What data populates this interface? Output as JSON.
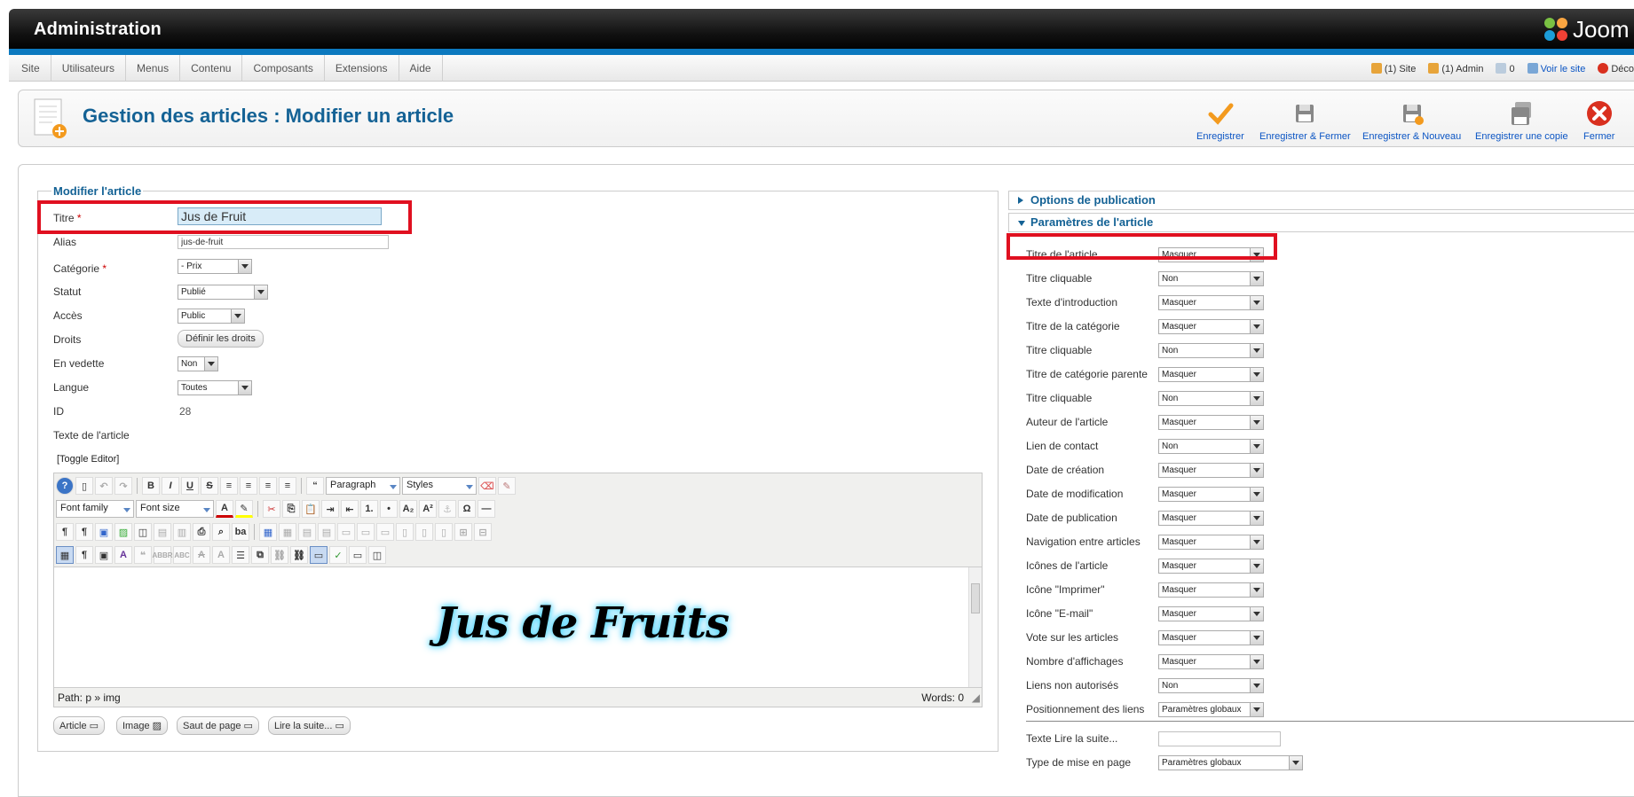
{
  "header": {
    "app_title": "Administration",
    "logo_text": "Joom"
  },
  "menu": {
    "items": [
      "Site",
      "Utilisateurs",
      "Menus",
      "Contenu",
      "Composants",
      "Extensions",
      "Aide"
    ]
  },
  "status": {
    "site": "(1) Site",
    "admin": "(1) Admin",
    "messages": "0",
    "view_site": "Voir le site",
    "logout": "Déco"
  },
  "toolbar": {
    "page_title": "Gestion des articles : Modifier un article",
    "buttons": [
      {
        "label": "Enregistrer",
        "icon": "checkmark-icon"
      },
      {
        "label": "Enregistrer & Fermer",
        "icon": "save-icon"
      },
      {
        "label": "Enregistrer & Nouveau",
        "icon": "save-new-icon"
      },
      {
        "label": "Enregistrer une copie",
        "icon": "save-copy-icon"
      },
      {
        "label": "Fermer",
        "icon": "close-icon"
      }
    ]
  },
  "form": {
    "legend": "Modifier l'article",
    "fields": {
      "title_label": "Titre",
      "title_value": "Jus de Fruit",
      "alias_label": "Alias",
      "alias_value": "jus-de-fruit",
      "category_label": "Catégorie",
      "category_value": "- Prix",
      "status_label": "Statut",
      "status_value": "Publié",
      "access_label": "Accès",
      "access_value": "Public",
      "rights_label": "Droits",
      "rights_button": "Définir les droits",
      "featured_label": "En vedette",
      "featured_value": "Non",
      "language_label": "Langue",
      "language_value": "Toutes",
      "id_label": "ID",
      "id_value": "28",
      "text_label": "Texte de l'article",
      "required_mark": "*"
    },
    "toggle_editor": "[Toggle Editor]"
  },
  "editor": {
    "format_select": "Paragraph",
    "styles_select": "Styles",
    "font_family": "Font family",
    "font_size": "Font size",
    "image_text": "Jus de Fruits",
    "path": "Path:  p » img",
    "words": "Words: 0",
    "buttons": [
      "Article",
      "Image",
      "Saut de page",
      "Lire la suite..."
    ]
  },
  "panel": {
    "publication_options": "Options de publication",
    "article_params": "Paramètres de l'article",
    "params": [
      {
        "label": "Titre de l'article",
        "value": "Masquer"
      },
      {
        "label": "Titre cliquable",
        "value": "Non"
      },
      {
        "label": "Texte d'introduction",
        "value": "Masquer"
      },
      {
        "label": "Titre de la catégorie",
        "value": "Masquer"
      },
      {
        "label": "Titre cliquable",
        "value": "Non"
      },
      {
        "label": "Titre de catégorie parente",
        "value": "Masquer"
      },
      {
        "label": "Titre cliquable",
        "value": "Non"
      },
      {
        "label": "Auteur de l'article",
        "value": "Masquer"
      },
      {
        "label": "Lien de contact",
        "value": "Non"
      },
      {
        "label": "Date de création",
        "value": "Masquer"
      },
      {
        "label": "Date de modification",
        "value": "Masquer"
      },
      {
        "label": "Date de publication",
        "value": "Masquer"
      },
      {
        "label": "Navigation entre articles",
        "value": "Masquer"
      },
      {
        "label": "Icônes de l'article",
        "value": "Masquer"
      },
      {
        "label": "Icône \"Imprimer\"",
        "value": "Masquer"
      },
      {
        "label": "Icône \"E-mail\"",
        "value": "Masquer"
      },
      {
        "label": "Vote sur les articles",
        "value": "Masquer"
      },
      {
        "label": "Nombre d'affichages",
        "value": "Masquer"
      },
      {
        "label": "Liens non autorisés",
        "value": "Non"
      },
      {
        "label": "Positionnement des liens",
        "value": "Paramètres globaux"
      }
    ],
    "readmore_label": "Texte Lire la suite...",
    "layout_label": "Type de mise en page",
    "layout_value": "Paramètres globaux"
  },
  "colors": {
    "accent_blue": "#0c79bf",
    "title_blue": "#146295",
    "highlight_red": "#e01020"
  }
}
